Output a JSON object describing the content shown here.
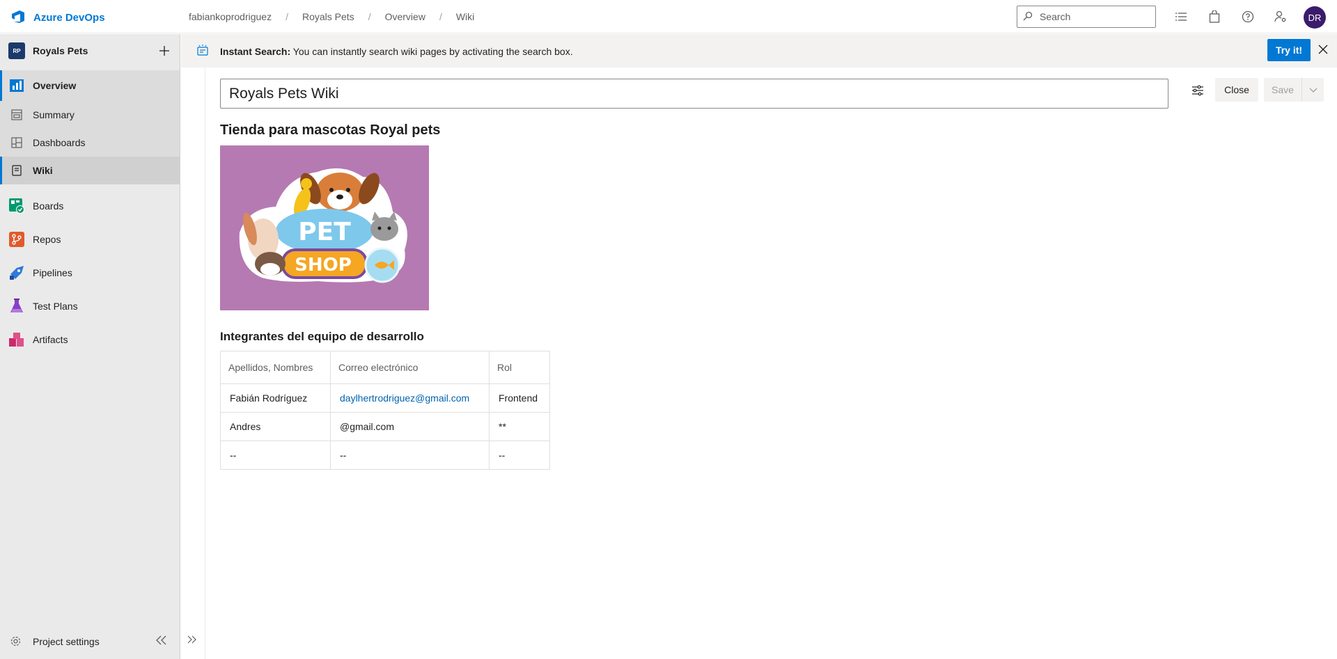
{
  "app": {
    "name": "Azure DevOps"
  },
  "breadcrumb": [
    "fabiankoprodriguez",
    "Royals Pets",
    "Overview",
    "Wiki"
  ],
  "search": {
    "placeholder": "Search"
  },
  "user": {
    "initials": "DR"
  },
  "project": {
    "badge": "RP",
    "name": "Royals Pets"
  },
  "sidebar": {
    "items": [
      {
        "label": "Overview"
      },
      {
        "label": "Summary"
      },
      {
        "label": "Dashboards"
      },
      {
        "label": "Wiki"
      },
      {
        "label": "Boards"
      },
      {
        "label": "Repos"
      },
      {
        "label": "Pipelines"
      },
      {
        "label": "Test Plans"
      },
      {
        "label": "Artifacts"
      }
    ],
    "settings_label": "Project settings"
  },
  "banner": {
    "title": "Instant Search:",
    "text": " You can instantly search wiki pages by activating the search box.",
    "button": "Try it!"
  },
  "editor": {
    "page_title": "Royals Pets Wiki",
    "close_label": "Close",
    "save_label": "Save"
  },
  "content": {
    "heading": "Tienda para mascotas Royal pets",
    "image_text": {
      "top": "PET",
      "bottom": "SHOP"
    },
    "team_heading": "Integrantes del equipo de desarrollo",
    "table": {
      "headers": [
        "Apellidos, Nombres",
        "Correo electrónico",
        "Rol"
      ],
      "rows": [
        [
          "Fabián Rodríguez",
          "daylhertrodriguez@gmail.com",
          "Frontend"
        ],
        [
          "Andres",
          "@gmail.com",
          "**"
        ],
        [
          "--",
          "--",
          "--"
        ]
      ]
    }
  },
  "colors": {
    "accent": "#0078d4",
    "image_background": "#b57ab2",
    "sidebar": "#eaeaea"
  }
}
